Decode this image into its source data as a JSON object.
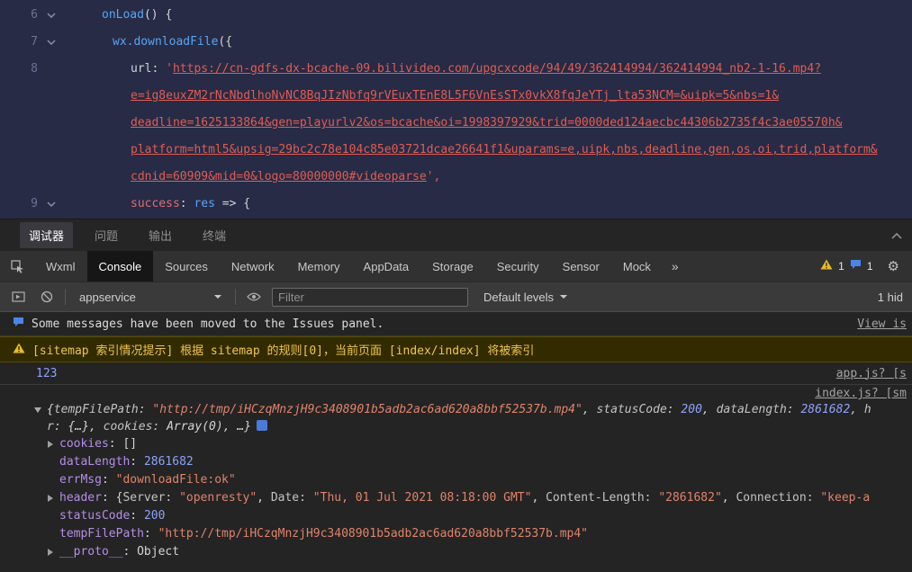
{
  "editor": {
    "gutter": {
      "n6": "6",
      "n7": "7",
      "n8": "8",
      "n9": "9"
    },
    "code": {
      "l6_fn": "onLoad",
      "l6_rest": "() {",
      "l7_fn": "wx.downloadFile",
      "l7_rest": "({",
      "l8_key": "url: ",
      "l8_quote": "'",
      "l8_url1": "https://cn-gdfs-dx-bcache-09.bilivideo.com/upgcxcode/94/49/362414994/362414994_nb2-1-16.mp4?",
      "l8_url2": "e=ig8euxZM2rNcNbdlhoNvNC8BqJIzNbfq9rVEuxTEnE8L5F6VnEsSTx0vkX8fqJeYTj_lta53NCM=&uipk=5&nbs=1&",
      "l8_url3": "deadline=1625133864&gen=playurlv2&os=bcache&oi=1998397929&trid=0000ded124aecbc44306b2735f4c3ae05570h&",
      "l8_url4": "platform=html5&upsig=29bc2c78e104c85e03721dcae26641f1&uparams=e,uipk,nbs,deadline,gen,os,oi,trid,platform&",
      "l8_url5": "cdnid=60909&mid=0&logo=80000000#videoparse",
      "l8_close": "',",
      "l9_key": "success",
      "l9_colon": ": ",
      "l9_param": "res",
      "l9_arrow": " => {"
    }
  },
  "panel": {
    "tabs": {
      "debugger": "调试器",
      "issues": "问题",
      "output": "输出",
      "terminal": "终端"
    },
    "devtools": {
      "wxml": "Wxml",
      "console": "Console",
      "sources": "Sources",
      "network": "Network",
      "memory": "Memory",
      "appdata": "AppData",
      "storage": "Storage",
      "security": "Security",
      "sensor": "Sensor",
      "mock": "Mock",
      "overflow": "»",
      "warning_count": "1",
      "message_count": "1"
    },
    "toolbar": {
      "context": "appservice",
      "filter_placeholder": "Filter",
      "levels": "Default levels",
      "hidden_count": "1 hid"
    }
  },
  "console": {
    "info": {
      "text": "Some messages have been moved to the Issues panel.",
      "source_link": "View is"
    },
    "warning": {
      "text": "[sitemap 索引情况提示] 根据 sitemap 的规则[0]，当前页面 [index/index] 将被索引"
    },
    "number_log": {
      "value": "123",
      "source_link": "app.js? [s"
    },
    "object_log": {
      "source_link": "index.js? [sm",
      "preview": {
        "open": "{",
        "k1": "tempFilePath: ",
        "v1": "\"http://tmp/iHCzqMnzjH9c3408901b5adb2ac6ad620a8bbf52537b.mp4\"",
        "s1": ", ",
        "k2": "statusCode: ",
        "v2": "200",
        "s2": ", ",
        "k3": "dataLength: ",
        "v3": "2861682",
        "s3": ", h",
        "l2a": "r: ",
        "l2b": "{…}, ",
        "l2c": "cookies: ",
        "l2d": "Array(0)",
        "l2e": ", …}"
      },
      "props": {
        "cookies": {
          "key": "cookies",
          "sep": ": ",
          "value": "[]"
        },
        "dataLength": {
          "key": "dataLength",
          "sep": ": ",
          "value": "2861682"
        },
        "errMsg": {
          "key": "errMsg",
          "sep": ": ",
          "value": "\"downloadFile:ok\""
        },
        "header": {
          "key": "header",
          "sep": ": ",
          "open": "{",
          "k1": "Server: ",
          "v1": "\"openresty\"",
          "s1": ", ",
          "k2": "Date: ",
          "v2": "\"Thu, 01 Jul 2021 08:18:00 GMT\"",
          "s2": ", ",
          "k3": "Content-Length: ",
          "v3": "\"2861682\"",
          "s3": ", ",
          "k4": "Connection: ",
          "v4": "\"keep-a"
        },
        "statusCode": {
          "key": "statusCode",
          "sep": ": ",
          "value": "200"
        },
        "tempFilePath": {
          "key": "tempFilePath",
          "sep": ": ",
          "value": "\"http://tmp/iHCzqMnzjH9c3408901b5adb2ac6ad620a8bbf52537b.mp4\""
        },
        "proto": {
          "key": "__proto__",
          "sep": ": ",
          "value": "Object"
        }
      }
    }
  }
}
